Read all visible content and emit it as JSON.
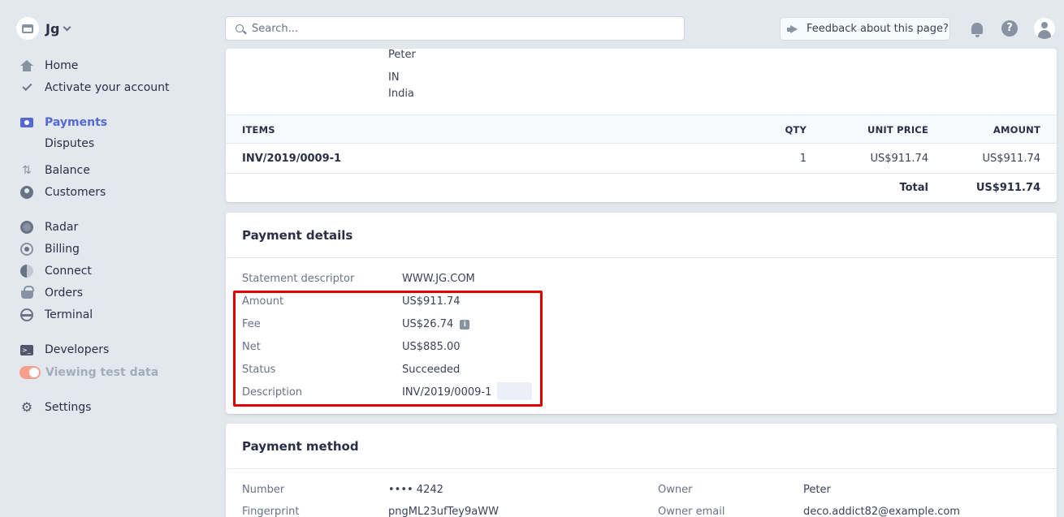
{
  "account": {
    "name": "Jg"
  },
  "nav": {
    "home": "Home",
    "activate": "Activate your account",
    "payments": "Payments",
    "disputes": "Disputes",
    "balance": "Balance",
    "customers": "Customers",
    "radar": "Radar",
    "billing": "Billing",
    "connect": "Connect",
    "orders": "Orders",
    "terminal": "Terminal",
    "developers": "Developers",
    "test_data": "Viewing test data",
    "settings": "Settings"
  },
  "topbar": {
    "search_placeholder": "Search...",
    "feedback": "Feedback about this page?"
  },
  "address": {
    "name": "Peter",
    "country_code": "IN",
    "country": "India"
  },
  "items_table": {
    "headers": {
      "items": "ITEMS",
      "qty": "QTY",
      "unit_price": "UNIT PRICE",
      "amount": "AMOUNT"
    },
    "rows": [
      {
        "item": "INV/2019/0009-1",
        "qty": "1",
        "unit_price": "US$911.74",
        "amount": "US$911.74"
      }
    ],
    "total_label": "Total",
    "total_value": "US$911.74"
  },
  "payment_details": {
    "title": "Payment details",
    "statement_descriptor_label": "Statement descriptor",
    "statement_descriptor": "WWW.JG.COM",
    "amount_label": "Amount",
    "amount": "US$911.74",
    "fee_label": "Fee",
    "fee": "US$26.74",
    "net_label": "Net",
    "net": "US$885.00",
    "status_label": "Status",
    "status": "Succeeded",
    "description_label": "Description",
    "description": "INV/2019/0009-1"
  },
  "payment_method": {
    "title": "Payment method",
    "number_label": "Number",
    "number": "•••• 4242",
    "fingerprint_label": "Fingerprint",
    "fingerprint": "pngML23ufTey9aWW",
    "owner_label": "Owner",
    "owner": "Peter",
    "owner_email_label": "Owner email",
    "owner_email": "deco.addict82@example.com"
  }
}
